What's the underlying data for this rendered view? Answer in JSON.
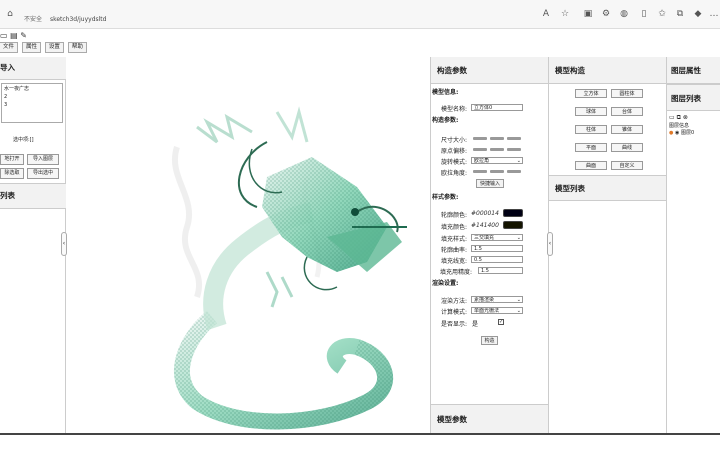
{
  "browser": {
    "security": "不安全",
    "url": "sketch3d/juyydsltd"
  },
  "menu": [
    "文件",
    "属性",
    "设置",
    "帮助"
  ],
  "left_panel": {
    "header": "导入",
    "list_items": [
      "水一夜广志",
      "2",
      "3"
    ],
    "selection_label": "选中项:[]",
    "buttons": [
      "地打开",
      "导入图层",
      "除选取",
      "导出选中"
    ],
    "footer_header": "列表"
  },
  "param_panel": {
    "header": "构造参数",
    "model_info_title": "模型信息:",
    "model_name_label": "模型名称:",
    "model_name_value": "立方体0",
    "construct_title": "构造参数:",
    "size_label": "尺寸大小:",
    "origin_label": "原点偏移:",
    "rotation_mode_label": "旋转模式:",
    "rotation_mode_value": "欧拉角",
    "euler_label": "欧拉角度:",
    "quick_input_button": "快捷输入",
    "style_title": "样式参数:",
    "outline_color_label": "轮廓颜色:",
    "outline_color_value": "#000014",
    "fill_color_label": "填充颜色:",
    "fill_color_value": "#141400",
    "fill_style_label": "填充样式:",
    "fill_style_value": "三交填充",
    "outline_roughness_label": "轮廓曲率:",
    "outline_roughness_value": "1.5",
    "fill_width_label": "填充线宽:",
    "fill_width_value": "0.5",
    "fill_precision_label": "填充用精度:",
    "fill_precision_value": "1.5",
    "render_title": "渲染设置:",
    "render_method_label": "渲染方法:",
    "render_method_value": "素描渲染",
    "compute_mode_label": "计算模式:",
    "compute_mode_value": "单面光栅法",
    "show_label": "是否显示:",
    "show_checkbox_left": "是",
    "build_button": "构造",
    "footer_header": "模型参数",
    "colors": {
      "outline": "#000014",
      "fill": "#141400"
    }
  },
  "construct_panel": {
    "header": "模型构造",
    "buttons": [
      "立方体",
      "圆柱体",
      "球体",
      "台体",
      "柱体",
      "锥体",
      "平面",
      "曲线",
      "曲面",
      "自定义"
    ],
    "list_header": "模型列表"
  },
  "layers_panel": {
    "header": "图层属性",
    "list_header": "图层列表",
    "tree_root": "图层信息",
    "tree_item": "图层0"
  }
}
